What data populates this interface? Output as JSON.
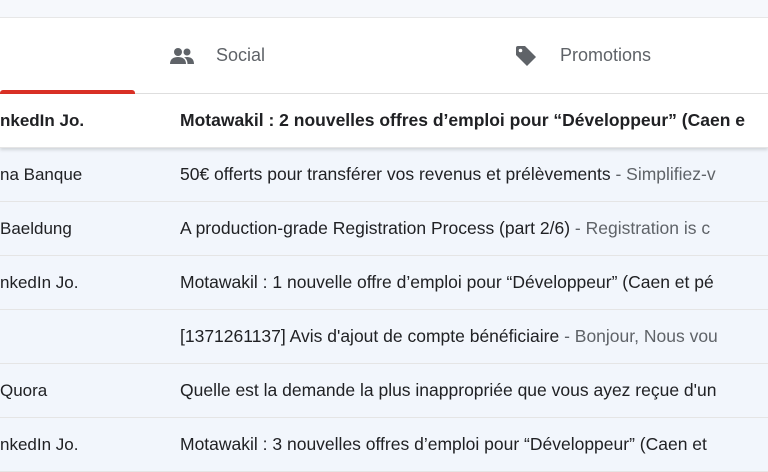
{
  "tabs": {
    "social": {
      "label": "Social",
      "icon": "people-icon"
    },
    "promotions": {
      "label": "Promotions",
      "icon": "tag-icon"
    },
    "active_color": "#d93025"
  },
  "rows": [
    {
      "sender": "nkedIn Jo.",
      "subject": "Motawakil : 2 nouvelles offres d’emploi pour “Développeur” (Caen e",
      "snippet": "",
      "unread": true
    },
    {
      "sender": "na Banque",
      "subject": "50€ offerts pour transférer vos revenus et prélèvements",
      "snippet": " - Simplifiez-v",
      "unread": false
    },
    {
      "sender": "Baeldung",
      "subject": "A production-grade Registration Process (part 2/6)",
      "snippet": " - Registration is c",
      "unread": false
    },
    {
      "sender": "nkedIn Jo.",
      "subject": "Motawakil : 1 nouvelle offre d’emploi pour “Développeur” (Caen et pé",
      "snippet": "",
      "unread": false
    },
    {
      "sender": "",
      "subject": "[1371261137] Avis d'ajout de compte bénéficiaire",
      "snippet": " - Bonjour, Nous vou",
      "unread": false
    },
    {
      "sender": "Quora",
      "subject": "Quelle est la demande la plus inappropriée que vous ayez reçue d'un",
      "snippet": "",
      "unread": false
    },
    {
      "sender": "nkedIn Jo.",
      "subject": "Motawakil : 3 nouvelles offres d’emploi pour “Développeur” (Caen et",
      "snippet": "",
      "unread": false
    }
  ]
}
